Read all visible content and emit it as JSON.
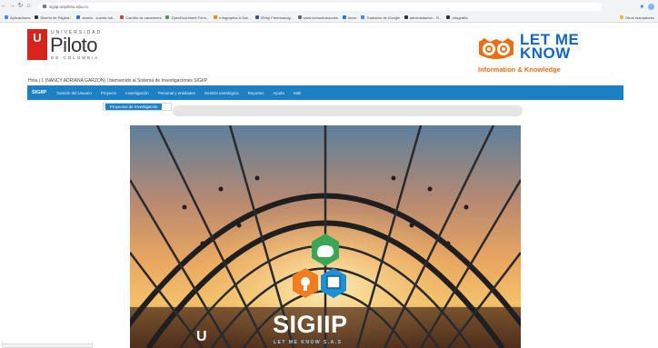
{
  "browser": {
    "url": "sigiip.unipiloto.edu.co",
    "bookmarks": [
      "Aplicaciones",
      "Diseño de Página...",
      "sesión - cuenta hdl...",
      "Cambio de caracteres",
      "OpenDocument Form...",
      "Infographía & Dat...",
      "iShop Freemumay...",
      "www.comunicaciones",
      "Inicio",
      "Traductor de Google",
      "administración - R...",
      "ortografía"
    ],
    "other_bookmarks": "Otros marcadores"
  },
  "header": {
    "upilot_top": "UNIVERSIDAD",
    "upilot_name": "Piloto",
    "upilot_bottom": "DE COLOMBIA",
    "upilot_mark": "U",
    "lmk_title": "LET ME KNOW",
    "lmk_sub": "Information & Knowledge"
  },
  "welcome_text": "Hola | 1 (NANCY ADRIANA GARZON) | bienvenido al Sistema de Investigaciones SIGIIP",
  "navbar": {
    "brand": "SIGIIP",
    "items": [
      "Gestión del Usuario",
      "Proyecto",
      "Investigación",
      "Personal y entidades",
      "Gestión estratégica",
      "Reportes",
      "Ayuda",
      "Salir"
    ]
  },
  "dropdown": {
    "item": "Proyectos de Investigación"
  },
  "hero": {
    "brand": "SIGIIP",
    "tagline": "LET ME KNOW S.A.S",
    "logo": "U"
  },
  "colors": {
    "nav": "#1d7fc4",
    "brand_red": "#d8241c",
    "lmk_blue": "#1565c0",
    "lmk_orange": "#e96e15"
  }
}
